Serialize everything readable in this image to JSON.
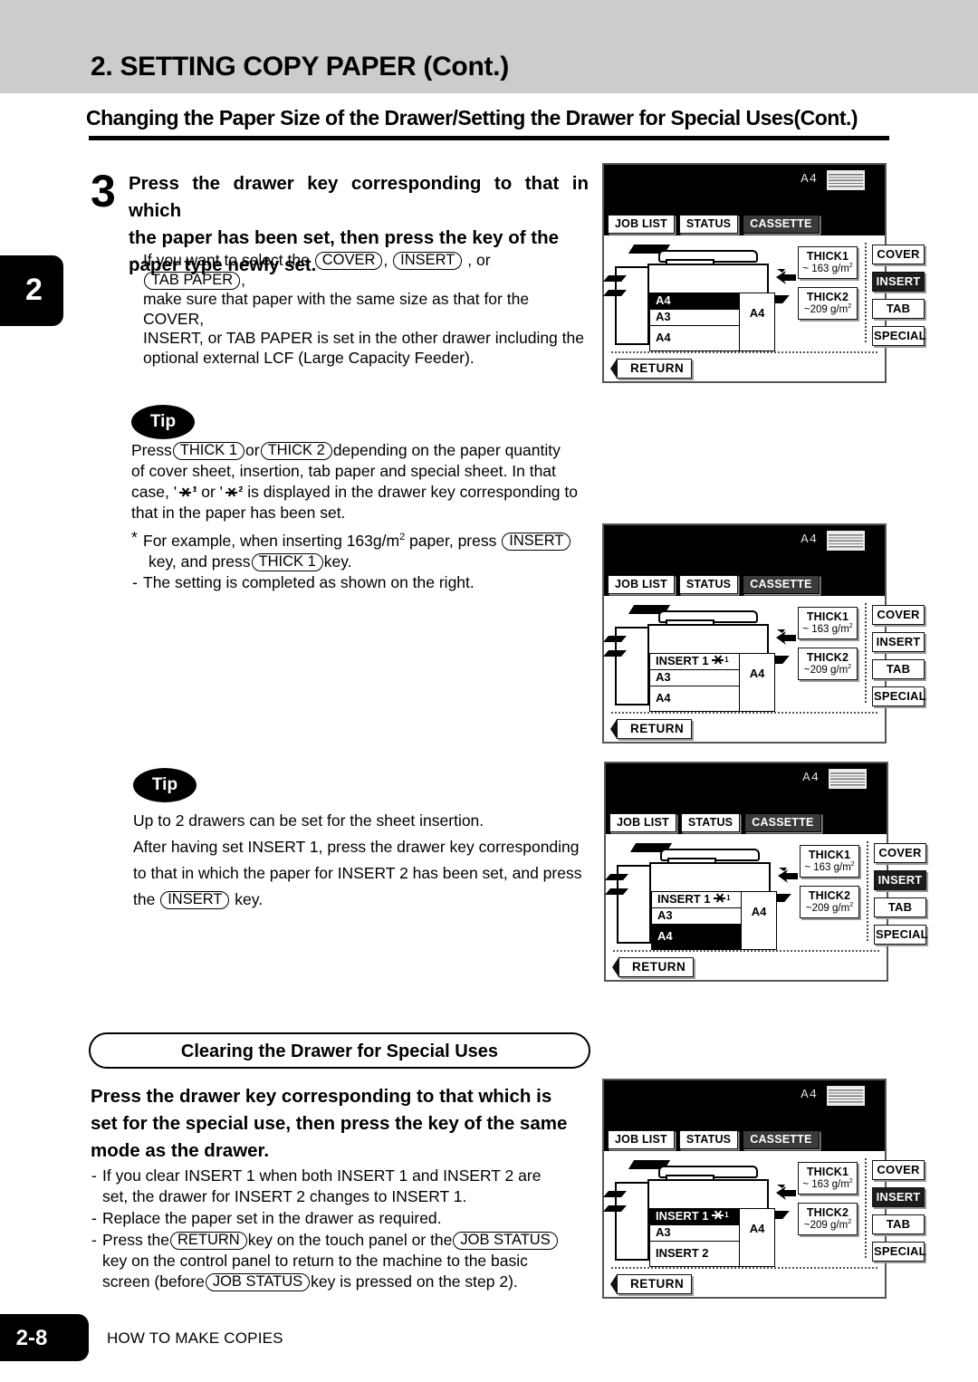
{
  "header": {
    "chapter_title": "2. SETTING COPY PAPER (Cont.)",
    "section_title": "Changing the Paper Size of the Drawer/Setting the Drawer for Special Uses(Cont.)",
    "chapter_tab": "2"
  },
  "step3": {
    "number": "3",
    "heading_line1": "Press the drawer key corresponding to that in which",
    "heading_line2": "the paper has been set, then press the key of the",
    "heading_line3": "paper type newly set.",
    "bullet1_a": "If you want to select the",
    "key_cover": "COVER",
    "bullet1_b": ",",
    "key_insert": "INSERT",
    "bullet1_c": ", or",
    "key_tab_paper": "TAB PAPER",
    "bullet1_d": ",",
    "bullet1_line2": "make sure that paper with the same size as that for the COVER,",
    "bullet1_line3": "INSERT, or TAB PAPER is set in the other drawer including the",
    "bullet1_line4": "optional external LCF (Large Capacity Feeder)."
  },
  "tip1": {
    "label": "Tip",
    "l1_a": "Press",
    "key_thick1": "THICK 1",
    "l1_b": "or",
    "key_thick2": "THICK 2",
    "l1_c": "depending on the paper quantity",
    "l2": "of cover sheet, insertion, tab paper and special sheet.  In that",
    "l3_a": "case, '",
    "l3_b": "' or '",
    "l3_c": "' is displayed in the drawer key corresponding to",
    "l4": "that in the paper has been set.",
    "l5_a": "For example, when inserting 163g/m",
    "l5_sup": "2",
    "l5_b": " paper, press",
    "l5_key": "INSERT",
    "l6_a": "key, and press",
    "l6_key": "THICK 1",
    "l6_b": "key.",
    "l7": "The setting is completed as shown on the right."
  },
  "tip2": {
    "label": "Tip",
    "l1": "Up to 2 drawers can be set for the sheet insertion.",
    "l2": "After having set INSERT 1, press the drawer key corresponding",
    "l3": "to that in which the paper for INSERT 2 has been set, and press",
    "l4_a": "the",
    "l4_key": "INSERT",
    "l4_b": "key."
  },
  "clearing": {
    "pill_title": "Clearing the Drawer for Special Uses",
    "heading_line1": "Press the drawer key corresponding to that which is",
    "heading_line2": "set for the special use, then press the key of the same",
    "heading_line3": "mode as the drawer.",
    "b1_l1": "If  you clear INSERT 1 when both INSERT 1 and INSERT 2 are",
    "b1_l2": "set, the drawer for INSERT 2 changes to INSERT 1.",
    "b2_l1": "Replace the paper set in the drawer as required.",
    "b3_a": "Press the",
    "b3_key1": "RETURN",
    "b3_b": "key on the touch panel or the",
    "b3_key2": "JOB STATUS",
    "b3_l2": "key on the control panel to return to the machine to the basic",
    "b3_l3_a": "screen (before",
    "b3_key3": "JOB STATUS",
    "b3_l3_b": "key is pressed on the step 2)."
  },
  "footer": {
    "page_number": "2-8",
    "running_head": "HOW TO MAKE COPIES"
  },
  "lcd_common": {
    "status_paper_size": "A4",
    "tabs": [
      "JOB LIST",
      "STATUS",
      "CASSETTE"
    ],
    "selected_tab": "CASSETTE",
    "thick_keys": [
      {
        "label": "THICK1",
        "weight": "~ 163 g/m",
        "sup": "2"
      },
      {
        "label": "THICK2",
        "weight": "~209 g/m",
        "sup": "2"
      }
    ],
    "mode_keys": [
      "COVER",
      "INSERT",
      "TAB",
      "SPECIAL"
    ],
    "return_label": "RETURN",
    "bypass_size": "A4"
  },
  "lcd_panels": [
    {
      "id": "panel-step3",
      "drawers": [
        {
          "label": "A4",
          "selected": true
        },
        {
          "label": "A3",
          "selected": false
        },
        {
          "label": "A4",
          "selected": false
        }
      ],
      "selected_mode": "INSERT",
      "selected_thick": null
    },
    {
      "id": "panel-tip1-result",
      "drawers": [
        {
          "label": "INSERT 1",
          "thick_mark": "1",
          "selected": false
        },
        {
          "label": "A3",
          "selected": false
        },
        {
          "label": "A4",
          "selected": false
        }
      ],
      "selected_mode": null,
      "selected_thick": null
    },
    {
      "id": "panel-tip2-result",
      "drawers": [
        {
          "label": "INSERT 1",
          "thick_mark": "1",
          "selected": false
        },
        {
          "label": "A3",
          "selected": false
        },
        {
          "label": "A4",
          "selected": true
        }
      ],
      "selected_mode": "INSERT",
      "selected_thick": null
    },
    {
      "id": "panel-clearing",
      "drawers": [
        {
          "label": "INSERT 1",
          "thick_mark": "1",
          "selected": true
        },
        {
          "label": "A3",
          "selected": false
        },
        {
          "label": "INSERT 2",
          "selected": false
        }
      ],
      "selected_mode": "INSERT",
      "selected_thick": null
    }
  ]
}
